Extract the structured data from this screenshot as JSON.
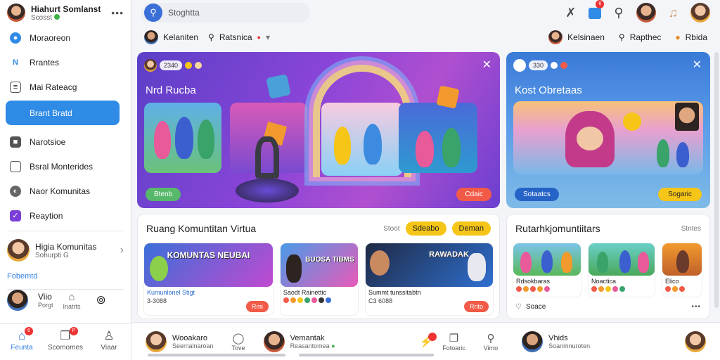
{
  "sidebar": {
    "profile": {
      "name": "Hiahurt Somlanst",
      "status": "Scosst"
    },
    "nav": [
      {
        "label": "Moraoreon",
        "icon": "chat-icon"
      },
      {
        "label": "Rrantes",
        "icon": "link-icon"
      },
      {
        "label": "Mai Rateacg",
        "icon": "document-icon"
      },
      {
        "label": "Brant Bratd",
        "icon": "bell-icon"
      },
      {
        "label": "Narotsioe",
        "icon": "square-icon"
      },
      {
        "label": "Bsral Monterides",
        "icon": "file-icon"
      },
      {
        "label": "Naor Komunitas",
        "icon": "globe-icon"
      },
      {
        "label": "Reaytion",
        "icon": "check-icon"
      }
    ],
    "community": {
      "name": "Higia Komunitas",
      "sub": "Sohurpti G"
    },
    "footer_link": "Fobemtd",
    "user_row": {
      "name": "Viio",
      "sub": "Porgt",
      "icon2_label": "Inatrts"
    },
    "bottom_tabs": [
      {
        "label": "Feunta",
        "icon": "home-icon",
        "badge": "6"
      },
      {
        "label": "Scomomes",
        "icon": "copy-icon",
        "badge": "P"
      },
      {
        "label": "Viaar",
        "icon": "user-icon"
      }
    ]
  },
  "topbar": {
    "search_placeholder": "Stoghtta",
    "badge": "6"
  },
  "subbar": {
    "left1": "Kelaniten",
    "left2": "Ratsnica",
    "right1": "Kelsinaen",
    "right2": "Rapthec",
    "right3": "Rbida"
  },
  "hero1": {
    "count": "2340",
    "title": "Nrd Rucba",
    "btn_left": "Btenb",
    "btn_right": "Cdaic"
  },
  "hero2": {
    "count": "330",
    "title": "Kost Obretaas",
    "btn_left": "Sotaatcs",
    "btn_right": "Sogaric"
  },
  "panelA": {
    "title": "Ruang Komuntitan Virtua",
    "meta": "Stoot",
    "chip1": "Sdeabo",
    "chip2": "Deman",
    "cards": [
      {
        "overlay": "KOMUNTAS NEUBAI",
        "line1": "Kumunlonel Stigt",
        "line2": "3-3088",
        "action": "Rmi"
      },
      {
        "overlay": "BUOSA TIBMS",
        "line1": "Saodt Rainettic",
        "line2": "",
        "action": ""
      },
      {
        "overlay": "RAWADAK",
        "line1": "Summt tunssitabtn",
        "line2": "C3 6088",
        "action": "Rrito"
      }
    ]
  },
  "panelB": {
    "title": "Rutarhkjomuntiitars",
    "meta": "Stntes",
    "cards": [
      {
        "line1": "Rdsokbaras"
      },
      {
        "line1": "Noactica"
      },
      {
        "line1": "Elico"
      }
    ],
    "foot": "Soace"
  },
  "bottom": {
    "u1": {
      "name": "Wooakaro",
      "sub": "Seemalnaroan"
    },
    "i1": "Tove",
    "u2": {
      "name": "Vemantak",
      "sub": "Reasantomea"
    },
    "i2": "Fotoaric",
    "i3": "Vimo",
    "u3": {
      "name": "Vhids",
      "sub": "Soanmnuroten"
    }
  }
}
